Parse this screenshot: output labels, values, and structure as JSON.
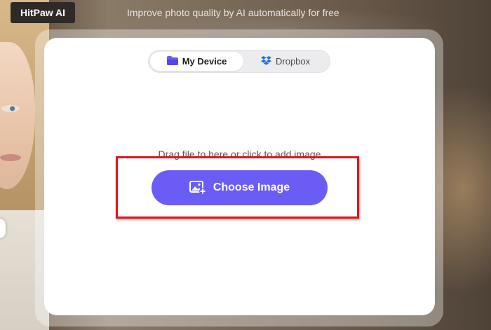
{
  "header": {
    "brand": "HitPaw AI",
    "tagline": "Improve photo quality by AI automatically for free"
  },
  "tabs": [
    {
      "label": "My Device",
      "icon": "folder-icon",
      "selected": true
    },
    {
      "label": "Dropbox",
      "icon": "dropbox-icon",
      "selected": false
    }
  ],
  "upload": {
    "hint": "Drag file to here or click to add image",
    "button_label": "Choose Image",
    "button_icon": "add-image-icon"
  },
  "colors": {
    "accent": "#6b5cf6",
    "highlight": "#e0151b",
    "folder": "#6b5cf6",
    "dropbox": "#1f6fe5"
  }
}
